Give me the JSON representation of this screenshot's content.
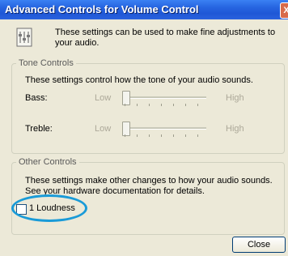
{
  "window": {
    "title": "Advanced Controls for Volume Control",
    "close_glyph": "X"
  },
  "header": {
    "icon": "settings-panel-icon",
    "text": "These settings can be used to make fine adjustments to your audio."
  },
  "tone_controls": {
    "legend": "Tone Controls",
    "description": "These settings control how the tone of your audio sounds.",
    "bass": {
      "label": "Bass:",
      "low": "Low",
      "high": "High",
      "level": 0.0
    },
    "treble": {
      "label": "Treble:",
      "low": "Low",
      "high": "High",
      "level": 0.0
    }
  },
  "other_controls": {
    "legend": "Other Controls",
    "description": "These settings make other changes to how your audio sounds.  See your hardware documentation for details.",
    "loudness": {
      "label": "1  Loudness",
      "checked": false
    }
  },
  "footer": {
    "close_label": "Close"
  },
  "colors": {
    "titlebar": "#2664e0",
    "dialog_bg": "#ece9d8",
    "annotation_ellipse": "#1a9bd8"
  }
}
